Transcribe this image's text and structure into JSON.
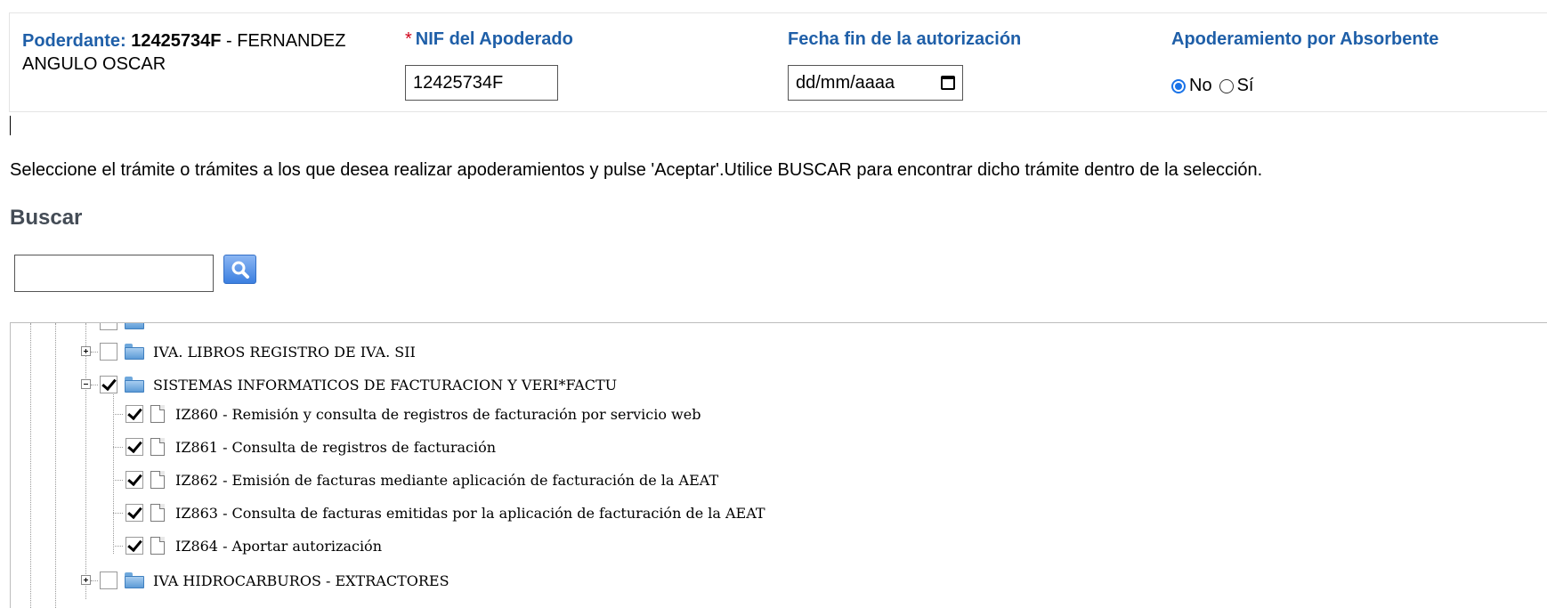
{
  "header": {
    "poderdante_label": "Poderdante:",
    "poderdante_nif": "12425734F",
    "poderdante_separator": "-",
    "poderdante_name": "FERNANDEZ ANGULO OSCAR",
    "nif_required_mark": "*",
    "nif_label": "NIF del Apoderado",
    "nif_value": "12425734F",
    "fecha_label": "Fecha fin de la autorización",
    "fecha_placeholder": "dd/mm/aaaa",
    "absorbente_label": "Apoderamiento por Absorbente",
    "absorbente_options": [
      {
        "label": "No",
        "selected": true
      },
      {
        "label": "Sí",
        "selected": false
      }
    ]
  },
  "instructions": "Seleccione el trámite o trámites a los que desea realizar apoderamientos y pulse 'Aceptar'.Utilice BUSCAR para encontrar dicho trámite dentro de la selección.",
  "search": {
    "title": "Buscar",
    "value": "",
    "button_icon": "magnifier-icon"
  },
  "tree": {
    "nodes": [
      {
        "label": "IVA. LIBROS REGISTRO DE IVA. SII",
        "type": "folder",
        "expanded": false,
        "checked": false
      },
      {
        "label": "SISTEMAS INFORMATICOS DE FACTURACION Y VERI*FACTU",
        "type": "folder",
        "expanded": true,
        "checked": true
      },
      {
        "label": "IZ860 - Remisión y consulta de registros de facturación por servicio web",
        "type": "document",
        "checked": true
      },
      {
        "label": "IZ861 - Consulta de registros de facturación",
        "type": "document",
        "checked": true
      },
      {
        "label": "IZ862 - Emisión de facturas mediante aplicación de facturación de la AEAT",
        "type": "document",
        "checked": true
      },
      {
        "label": "IZ863 - Consulta de facturas emitidas por la aplicación de facturación de la AEAT",
        "type": "document",
        "checked": true
      },
      {
        "label": "IZ864 - Aportar autorización",
        "type": "document",
        "checked": true
      },
      {
        "label": "IVA HIDROCARBUROS - EXTRACTORES",
        "type": "folder",
        "expanded": false,
        "checked": false
      }
    ]
  },
  "colors": {
    "label_blue": "#1f5fa8",
    "required_red": "#d0021b",
    "radio_blue": "#1a73e8",
    "folder_blue": "#5d9bd6"
  }
}
